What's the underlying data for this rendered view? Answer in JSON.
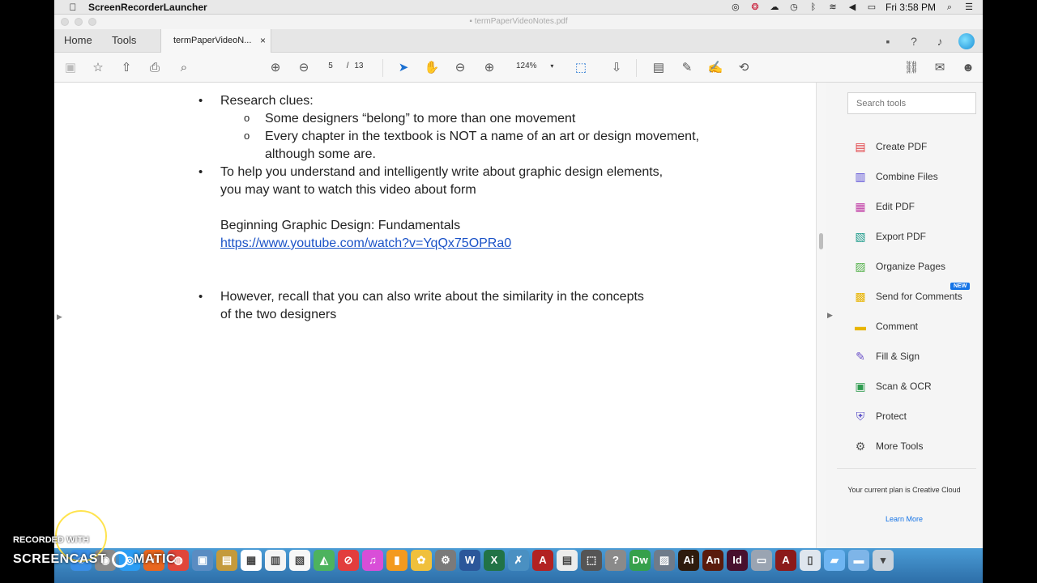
{
  "menubar": {
    "app_name": "ScreenRecorderLauncher",
    "clock": "Fri 3:58 PM"
  },
  "window": {
    "title": "termPaperVideoNotes.pdf"
  },
  "tabs": {
    "home": "Home",
    "tools": "Tools",
    "doc": "termPaperVideoN...",
    "close": "×"
  },
  "toolbar": {
    "page_current": "5",
    "page_sep": "/",
    "page_total": "13",
    "zoom": "124%"
  },
  "document": {
    "b1": "Research clues:",
    "b1_sub1": "Some designers “belong” to more than one movement",
    "b1_sub2": "Every chapter in the textbook is NOT a name of an art or design movement, although some are.",
    "b2": "To help you understand and intelligently write about graphic design elements, you may want to watch this video about form",
    "video_title": "Beginning Graphic Design: Fundamentals",
    "video_url": "https://www.youtube.com/watch?v=YqQx75OPRa0",
    "b3": "However, recall that you can also write about the similarity in the concepts of the two designers"
  },
  "right_panel": {
    "search_placeholder": "Search tools",
    "tools": [
      {
        "label": "Create PDF",
        "icon": "create-pdf-icon",
        "color": "#e0393e"
      },
      {
        "label": "Combine Files",
        "icon": "combine-files-icon",
        "color": "#5b4fd6"
      },
      {
        "label": "Edit PDF",
        "icon": "edit-pdf-icon",
        "color": "#c13fa6"
      },
      {
        "label": "Export PDF",
        "icon": "export-pdf-icon",
        "color": "#1b9a8a"
      },
      {
        "label": "Organize Pages",
        "icon": "organize-pages-icon",
        "color": "#53b04a"
      },
      {
        "label": "Send for Comments",
        "icon": "send-comments-icon",
        "color": "#e8b400"
      },
      {
        "label": "Comment",
        "icon": "comment-icon",
        "color": "#e8b400"
      },
      {
        "label": "Fill & Sign",
        "icon": "fill-sign-icon",
        "color": "#6a4fc8"
      },
      {
        "label": "Scan & OCR",
        "icon": "scan-ocr-icon",
        "color": "#2e9b4f"
      },
      {
        "label": "Protect",
        "icon": "protect-icon",
        "color": "#5a4fc8"
      },
      {
        "label": "More Tools",
        "icon": "more-tools-icon",
        "color": "#555555"
      }
    ],
    "new_badge": "NEW",
    "plan_text": "Your current plan is Creative Cloud",
    "learn_more": "Learn More"
  },
  "watermark": {
    "line1": "RECORDED WITH",
    "line2": "SCREENCAST",
    "line3": "MATIC"
  }
}
